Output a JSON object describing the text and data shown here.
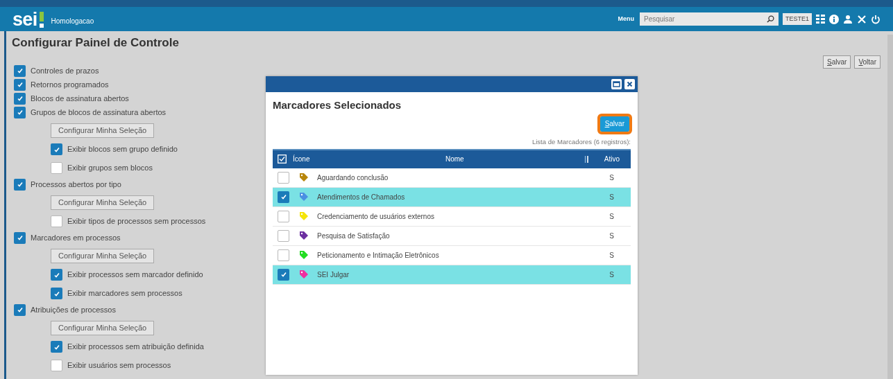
{
  "header": {
    "logo": "sei",
    "environment": "Homologacao",
    "menu_label": "Menu",
    "search_placeholder": "Pesquisar",
    "unit": "TESTE1"
  },
  "page": {
    "title": "Configurar Painel de Controle",
    "buttons": [
      "Salvar",
      "Voltar"
    ]
  },
  "options": [
    {
      "kind": "checkbox",
      "label": "Controles de prazos",
      "checked": true
    },
    {
      "kind": "checkbox",
      "label": "Retornos programados",
      "checked": true
    },
    {
      "kind": "checkbox",
      "label": "Blocos de assinatura abertos",
      "checked": true
    },
    {
      "kind": "checkbox",
      "label": "Grupos de blocos de assinatura abertos",
      "checked": true,
      "children": [
        {
          "kind": "button",
          "label": "Configurar Minha Seleção"
        },
        {
          "kind": "checkbox",
          "label": "Exibir blocos sem grupo definido",
          "checked": true
        },
        {
          "kind": "checkbox",
          "label": "Exibir grupos sem blocos",
          "checked": false
        }
      ]
    },
    {
      "kind": "checkbox",
      "label": "Processos abertos por tipo",
      "checked": true,
      "children": [
        {
          "kind": "button",
          "label": "Configurar Minha Seleção"
        },
        {
          "kind": "checkbox",
          "label": "Exibir tipos de processos sem processos",
          "checked": false
        }
      ]
    },
    {
      "kind": "checkbox",
      "label": "Marcadores em processos",
      "checked": true,
      "children": [
        {
          "kind": "button",
          "label": "Configurar Minha Seleção"
        },
        {
          "kind": "checkbox",
          "label": "Exibir processos sem marcador definido",
          "checked": true
        },
        {
          "kind": "checkbox",
          "label": "Exibir marcadores sem processos",
          "checked": true
        }
      ]
    },
    {
      "kind": "checkbox",
      "label": "Atribuições de processos",
      "checked": true,
      "children": [
        {
          "kind": "button",
          "label": "Configurar Minha Seleção"
        },
        {
          "kind": "checkbox",
          "label": "Exibir processos sem atribuição definida",
          "checked": true
        },
        {
          "kind": "checkbox",
          "label": "Exibir usuários sem processos",
          "checked": false
        }
      ]
    }
  ],
  "modal": {
    "title": "Marcadores Selecionados",
    "save_button": "Salvar",
    "caption": "Lista de Marcadores (6 registros):",
    "columns": [
      "Ícone",
      "Nome",
      "Ativo"
    ],
    "rows": [
      {
        "name": "Aguardando conclusão",
        "color": "#b8860b",
        "selected": false,
        "active": "S"
      },
      {
        "name": "Atendimentos de Chamados",
        "color": "#4a90e2",
        "selected": true,
        "active": "S"
      },
      {
        "name": "Credenciamento de usuários externos",
        "color": "#f5e50a",
        "selected": false,
        "active": "S"
      },
      {
        "name": "Pesquisa de Satisfação",
        "color": "#6b2fa0",
        "selected": false,
        "active": "S"
      },
      {
        "name": "Peticionamento e Intimação Eletrônicos",
        "color": "#22dd22",
        "selected": false,
        "active": "S"
      },
      {
        "name": "SEI Julgar",
        "color": "#ee2ea0",
        "selected": true,
        "active": "S"
      }
    ]
  }
}
